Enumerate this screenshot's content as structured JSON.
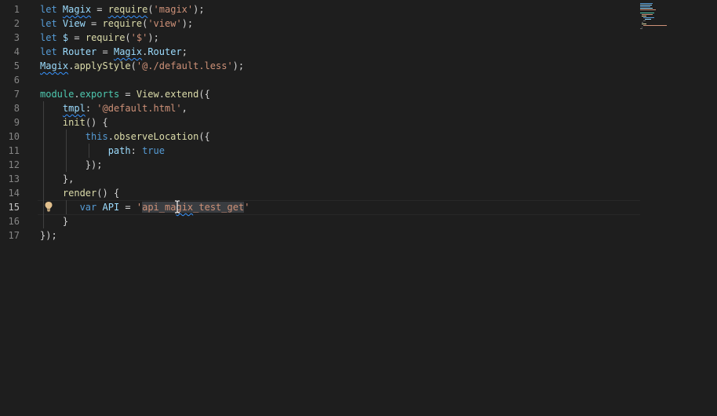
{
  "editor": {
    "line_numbers": [
      "1",
      "2",
      "3",
      "4",
      "5",
      "6",
      "7",
      "8",
      "9",
      "10",
      "11",
      "12",
      "13",
      "14",
      "15",
      "16",
      "17"
    ],
    "active_line": "15"
  },
  "code": {
    "l1": {
      "kw": "let",
      "var": "Magix",
      "eq": " = ",
      "fn": "require",
      "p1": "(",
      "str": "'magix'",
      "p2": ");"
    },
    "l2": {
      "kw": "let",
      "var": "View",
      "eq": " = ",
      "fn": "require",
      "p1": "(",
      "str": "'view'",
      "p2": ");"
    },
    "l3": {
      "kw": "let",
      "var": "$",
      "eq": " = ",
      "fn": "require",
      "p1": "(",
      "str": "'$'",
      "p2": ");"
    },
    "l4": {
      "kw": "let",
      "var": "Router",
      "eq": " = ",
      "obj": "Magix",
      "dot": ".",
      "prop": "Router",
      "end": ";"
    },
    "l5": {
      "obj": "Magix",
      "dot": ".",
      "fn": "applyStyle",
      "p1": "(",
      "str": "'@./default.less'",
      "p2": ");"
    },
    "l7": {
      "obj": "module",
      "dot1": ".",
      "prop": "exports",
      "eq": " = ",
      "cls": "View",
      "dot2": ".",
      "fn": "extend",
      "p": "({"
    },
    "l8": {
      "key": "tmpl",
      "colon": ": ",
      "str": "'@default.html'",
      "comma": ","
    },
    "l9": {
      "fn": "init",
      "p": "() {"
    },
    "l10": {
      "kw": "this",
      "dot": ".",
      "fn": "observeLocation",
      "p": "({"
    },
    "l11": {
      "key": "path",
      "colon": ": ",
      "val": "true"
    },
    "l12": {
      "p": "});"
    },
    "l13": {
      "p": "},"
    },
    "l14": {
      "fn": "render",
      "p": "() {"
    },
    "l15": {
      "kw": "var",
      "var": "API",
      "eq": " = ",
      "q1": "'",
      "s1": "api_ma",
      "s2": "gix",
      "s3": "_test_get",
      "q2": "'"
    },
    "l16": {
      "p": "}"
    },
    "l17": {
      "p": "});"
    }
  },
  "colors": {
    "background": "#1e1e1e",
    "keyword": "#569cd6",
    "variable": "#9cdcfe",
    "function": "#dcdcaa",
    "string": "#ce9178",
    "class": "#4ec9b0",
    "squiggle": "#3794ff"
  },
  "icons": {
    "lightbulb": "lightbulb-icon",
    "text_cursor": "text-cursor-icon"
  }
}
